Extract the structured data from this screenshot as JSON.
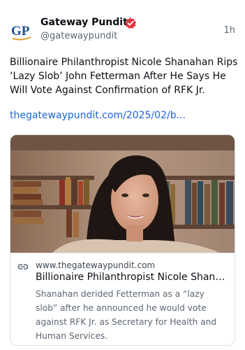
{
  "post": {
    "author": "Gateway Pundit",
    "handle": "@gatewaypundit",
    "time": "1h",
    "avatar_text": "GP",
    "verified_icon": "verified-badge-icon",
    "text": "Billionaire Philanthropist Nicole Shanahan Rips ‘Lazy Slob’ John Fetterman After He Says He Will Vote Against Confirmation of RFK Jr.",
    "link": "thegatewaypundit.com/2025/02/b..."
  },
  "card": {
    "domain": "www.thegatewaypundit.com",
    "title": "Billionaire Philanthropist Nicole Shana...",
    "description": "Shanahan derided Fetterman as a “lazy slob” after he announced he would vote against RFK Jr. as Secretary for Health and Human Services.",
    "link_icon": "link-icon"
  },
  "colors": {
    "link": "#1b64d8",
    "brand_blue": "#1d4f91",
    "brand_gold": "#e2a12c",
    "badge": "#e3343f"
  }
}
